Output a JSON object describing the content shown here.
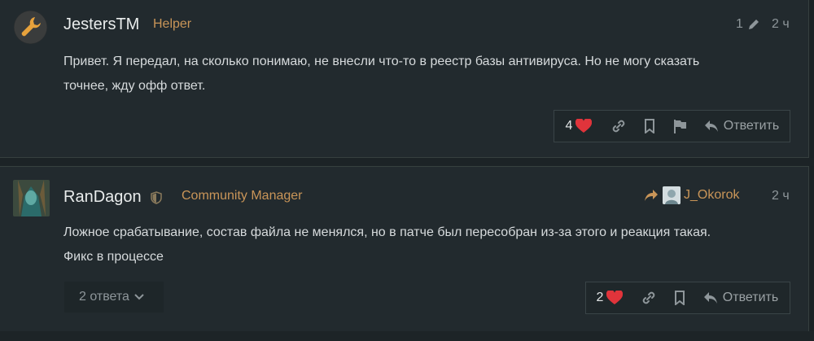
{
  "posts": [
    {
      "username": "JestersTM",
      "role": "Helper",
      "edit_count": "1",
      "time": "2 ч",
      "body_line1": "Привет. Я передал, на сколько понимаю, не внесли что-то в реестр базы антивируса. Но не могу сказать",
      "body_line2": "точнее, жду офф ответ.",
      "likes": "4",
      "reply_label": "Ответить"
    },
    {
      "username": "RanDagon",
      "role": "Community Manager",
      "reply_to": "J_Okorok",
      "time": "2 ч",
      "body_line1": "Ложное срабатывание, состав файла не менялся, но в патче был пересобран из-за этого и реакция такая.",
      "body_line2": "Фикс в процессе",
      "replies_label": "2 ответа",
      "likes": "2",
      "reply_label": "Ответить"
    }
  ],
  "colors": {
    "accent": "#c99558",
    "heart": "#e0343b",
    "background": "#1b2225",
    "panel": "#222a2e"
  },
  "icons": [
    "wrench-icon",
    "pencil-icon",
    "heart-icon",
    "link-icon",
    "bookmark-icon",
    "flag-icon",
    "reply-icon",
    "shield-icon",
    "share-arrow-icon",
    "chevron-down-icon"
  ]
}
